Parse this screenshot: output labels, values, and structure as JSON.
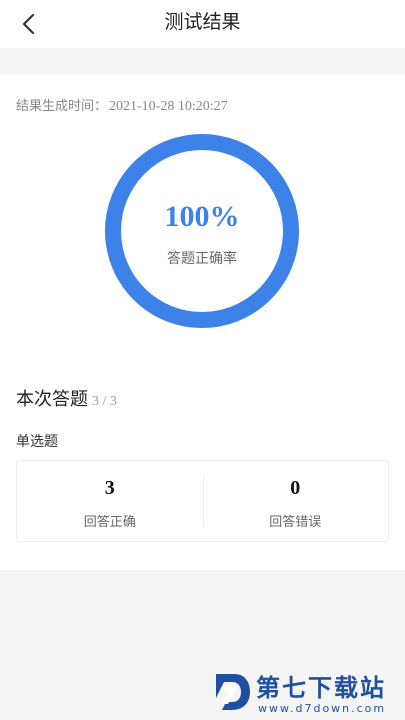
{
  "header": {
    "title": "测试结果"
  },
  "result": {
    "generated_label": "结果生成时间：",
    "generated_value": "2021-10-28 10:20:27",
    "percent": "100%",
    "percent_label": "答题正确率",
    "progress_fraction": 1.0,
    "ring_color": "#3d82e8"
  },
  "summary": {
    "title": "本次答题",
    "count": "3 / 3",
    "type_label": "单选题",
    "stats": [
      {
        "value": "3",
        "label": "回答正确"
      },
      {
        "value": "0",
        "label": "回答错误"
      }
    ]
  },
  "watermark": {
    "title": "第七下载站",
    "url": "www.d7down.com"
  }
}
